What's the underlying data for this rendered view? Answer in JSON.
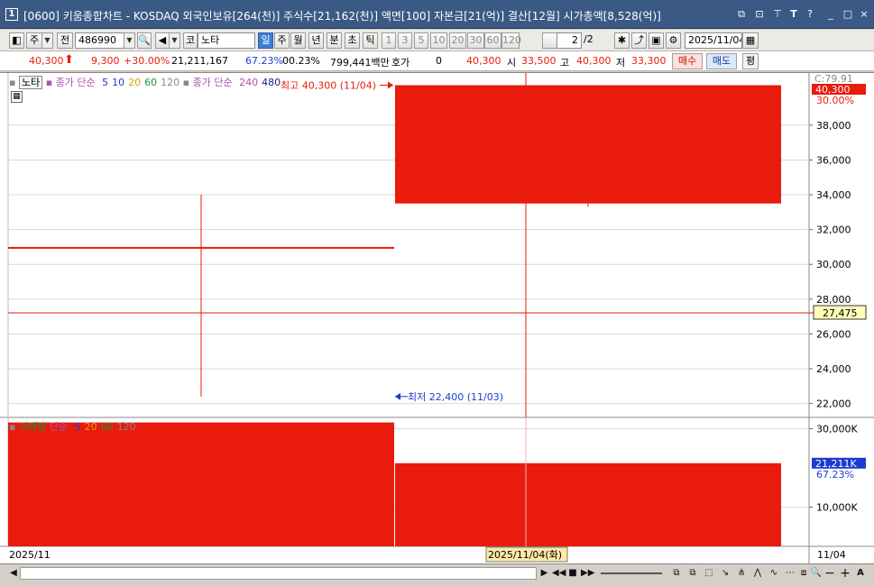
{
  "window": {
    "number": "1",
    "title": "[0600] 키움종합차트 - KOSDAQ 외국인보유[264(천)] 주식수[21,162(천)] 액면[100] 자본금[21(억)] 결산[12월] 시가총액[8,528(억)]",
    "controls": [
      "⧉",
      "⊡",
      "⊤",
      "T",
      "?",
      "_",
      "□",
      "×"
    ]
  },
  "toolbar": {
    "market_type": "주",
    "prev_label": "전",
    "stock_code": "486990",
    "code_prefix": "코",
    "stock_name": "노타",
    "periods": [
      "일",
      "주",
      "월",
      "년",
      "분",
      "초",
      "틱"
    ],
    "active_period": "일",
    "intervals": [
      "1",
      "3",
      "5",
      "10",
      "20",
      "30",
      "60",
      "120"
    ],
    "page_value": "2",
    "page_total": "/2",
    "date": "2025/11/04"
  },
  "quote": {
    "price": "40,300",
    "change": "9,300",
    "change_pct": "+30.00%",
    "volume": "21,211,167",
    "volume_ratio": "67.23%",
    "turnover": "00.23%",
    "amount": "799,441백만",
    "hoga_label": "호가",
    "hoga_value": "0",
    "current": "40,300",
    "open_label": "시",
    "open_value": "33,500",
    "high_label": "고",
    "high_value": "40,300",
    "low_label": "저",
    "low_value": "33,300",
    "buy_label": "매수",
    "sell_label": "매도",
    "eval_label": "평"
  },
  "legend_top": {
    "stock": "노타",
    "ma_prefix": "종가 단순",
    "ma_periods": [
      {
        "label": "5",
        "color": "#1d3bd0"
      },
      {
        "label": "10",
        "color": "#1d3bd0"
      },
      {
        "label": "20",
        "color": "#e0a000"
      },
      {
        "label": "60",
        "color": "#1a9a2a"
      },
      {
        "label": "120",
        "color": "#888888"
      }
    ],
    "ma2_prefix": "종가 단순",
    "ma2_periods": [
      {
        "label": "240",
        "color": "#b04fb0"
      },
      {
        "label": "480",
        "color": "#1d1d80"
      }
    ]
  },
  "legend_volume": {
    "label": "거래량",
    "ma_prefix": "단순",
    "ma_periods": [
      {
        "label": "5",
        "color": "#1d3bd0"
      },
      {
        "label": "20",
        "color": "#e0a000"
      },
      {
        "label": "60",
        "color": "#1a9a2a"
      },
      {
        "label": "120",
        "color": "#888888"
      }
    ]
  },
  "annotations": {
    "high": "최고 40,300 (11/04)",
    "low": "최저 22,400 (11/03)",
    "c_label": "C:79.91",
    "last_price_tag": "40,300",
    "last_pct_tag": "30.00%",
    "crosshair_tag": "27,475",
    "volume_tag": "21,211K",
    "volume_pct_tag": "67.23%",
    "x_start_label": "2025/11",
    "crosshair_date": "2025/11/04(화)",
    "x_end_label": "11/04"
  },
  "colors": {
    "up_candle": "#e81b0c",
    "grid": "#d8d8d8",
    "crosshair": "#e81b0c"
  },
  "chart_data": [
    {
      "type": "candlestick",
      "x": [
        "11/03",
        "11/04"
      ],
      "open": [
        31000,
        33500
      ],
      "high": [
        34000,
        40300
      ],
      "low": [
        22400,
        33300
      ],
      "close": [
        31000,
        40300
      ],
      "y_ticks": [
        "22,000",
        "24,000",
        "26,000",
        "28,000",
        "30,000",
        "32,000",
        "34,000",
        "36,000",
        "38,000"
      ],
      "ylim": [
        21200,
        41000
      ]
    },
    {
      "type": "bar",
      "title": "거래량",
      "categories": [
        "11/03",
        "11/04"
      ],
      "values": [
        31600,
        21211
      ],
      "y_ticks": [
        "10,000K",
        "30,000K"
      ],
      "ylim": [
        0,
        32200
      ]
    }
  ]
}
